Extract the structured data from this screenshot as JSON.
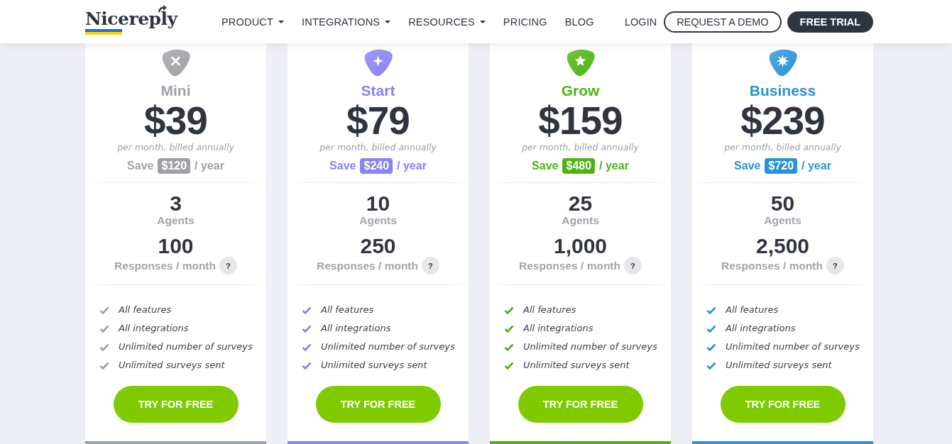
{
  "header": {
    "logo": "Nicereply",
    "nav": [
      {
        "label": "PRODUCT",
        "dropdown": true
      },
      {
        "label": "INTEGRATIONS",
        "dropdown": true
      },
      {
        "label": "RESOURCES",
        "dropdown": true
      },
      {
        "label": "PRICING",
        "dropdown": false
      },
      {
        "label": "BLOG",
        "dropdown": false
      }
    ],
    "login": "LOGIN",
    "demo_button": "REQUEST A DEMO",
    "trial_button": "FREE TRIAL"
  },
  "plans": [
    {
      "kind": "cross",
      "color": "#9da2a8",
      "name": "Mini",
      "price": "$39",
      "billing": "per month, billed annually",
      "save_label": "Save",
      "save_amount": "$120",
      "save_period": "/ year",
      "agents": "3",
      "agents_label": "Agents",
      "responses": "100",
      "responses_label": "Responses / month",
      "help": "?",
      "features": [
        "All features",
        "All integrations",
        "Unlimited number of surveys",
        "Unlimited surveys sent"
      ],
      "button": "TRY FOR FREE"
    },
    {
      "kind": "sparkle",
      "color": "#8682f7",
      "name": "Start",
      "price": "$79",
      "billing": "per month, billed annually",
      "save_label": "Save",
      "save_amount": "$240",
      "save_period": "/ year",
      "agents": "10",
      "agents_label": "Agents",
      "responses": "250",
      "responses_label": "Responses / month",
      "help": "?",
      "features": [
        "All features",
        "All integrations",
        "Unlimited number of surveys",
        "Unlimited surveys sent"
      ],
      "button": "TRY FOR FREE"
    },
    {
      "kind": "star",
      "color": "#4cb412",
      "name": "Grow",
      "price": "$159",
      "billing": "per month, billed annually",
      "save_label": "Save",
      "save_amount": "$480",
      "save_period": "/ year",
      "agents": "25",
      "agents_label": "Agents",
      "responses": "1,000",
      "responses_label": "Responses / month",
      "help": "?",
      "features": [
        "All features",
        "All integrations",
        "Unlimited number of surveys",
        "Unlimited surveys sent"
      ],
      "button": "TRY FOR FREE"
    },
    {
      "kind": "burst",
      "color": "#2a92d8",
      "name": "Business",
      "price": "$239",
      "billing": "per month, billed annually",
      "save_label": "Save",
      "save_amount": "$720",
      "save_period": "/ year",
      "agents": "50",
      "agents_label": "Agents",
      "responses": "2,500",
      "responses_label": "Responses / month",
      "help": "?",
      "features": [
        "All features",
        "All integrations",
        "Unlimited number of surveys",
        "Unlimited surveys sent"
      ],
      "button": "TRY FOR FREE"
    }
  ]
}
